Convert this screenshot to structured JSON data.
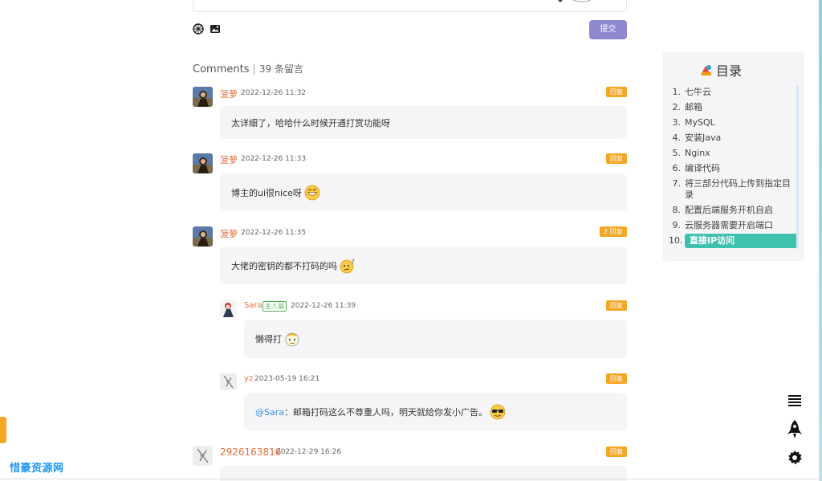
{
  "editor": {
    "submit_label": "提交"
  },
  "comments_header": {
    "title": "Comments",
    "count_text": "39 条留言"
  },
  "comments": [
    {
      "name": "菠萝",
      "date": "2022-12-26 11:32",
      "reply": "回复",
      "text": "太详细了，哈哈什么时候开通打赏功能呀"
    },
    {
      "name": "菠萝",
      "date": "2022-12-26 11:33",
      "reply": "回复",
      "text": "博主的ui很nice呀"
    },
    {
      "name": "菠萝",
      "date": "2022-12-26 11:35",
      "reply": "2 回复",
      "text": "大佬的密钥的都不打码的吗"
    },
    {
      "name": "Sara",
      "badge": "主人翁",
      "date": "2022-12-26 11:39",
      "reply": "回复",
      "text": "懒得打"
    },
    {
      "name": "yz",
      "date": "2023-05-19 16:21",
      "reply": "回复",
      "mention": "@Sara",
      "text": "：邮箱打码这么不尊重人吗，明天就给你发小广告。"
    },
    {
      "name": "2926163816",
      "date": "2022-12-29 16:26",
      "reply": "回复",
      "text": ""
    }
  ],
  "toc": {
    "title": "目录",
    "items": [
      {
        "num": "1.",
        "label": "七牛云"
      },
      {
        "num": "2.",
        "label": "邮箱"
      },
      {
        "num": "3.",
        "label": "MySQL"
      },
      {
        "num": "4.",
        "label": "安装Java"
      },
      {
        "num": "5.",
        "label": "Nginx"
      },
      {
        "num": "6.",
        "label": "编译代码"
      },
      {
        "num": "7.",
        "label": "将三部分代码上传到指定目录"
      },
      {
        "num": "8.",
        "label": "配置后端服务开机自启"
      },
      {
        "num": "9.",
        "label": "云服务器需要开启端口"
      },
      {
        "num": "10.",
        "label": "直接IP访问",
        "active": true
      }
    ]
  },
  "site": {
    "logo_text": "惜豪资源网"
  },
  "colors": {
    "accent": "#8e88cf",
    "reply": "#f5a623",
    "toc_active": "#3fc1b0",
    "name": "#e8703a"
  },
  "icons": [
    "emoji-picker-icon",
    "image-upload-icon",
    "menu-icon",
    "rocket-icon",
    "gear-icon"
  ]
}
